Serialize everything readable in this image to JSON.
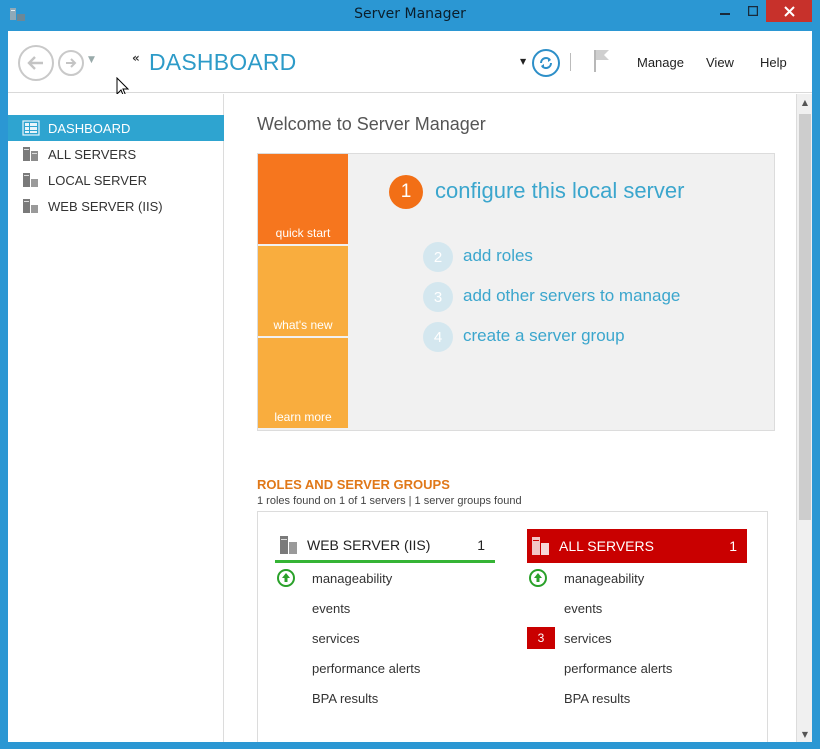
{
  "window": {
    "title": "Server Manager"
  },
  "toolbar": {
    "page_title": "DASHBOARD",
    "menus": [
      {
        "label": "Manage"
      },
      {
        "label": "View"
      },
      {
        "label": "Help"
      }
    ]
  },
  "sidebar": {
    "items": [
      {
        "label": "DASHBOARD",
        "active": true,
        "icon": "dashboard-icon"
      },
      {
        "label": "ALL SERVERS",
        "active": false,
        "icon": "servers-icon"
      },
      {
        "label": "LOCAL SERVER",
        "active": false,
        "icon": "server-icon"
      },
      {
        "label": "WEB SERVER (IIS)",
        "active": false,
        "icon": "server-icon"
      }
    ]
  },
  "main": {
    "welcome": "Welcome to Server Manager",
    "tiles": [
      {
        "label": "quick start",
        "color": "#f6761e"
      },
      {
        "label": "what's new",
        "color": "#f9ad3e"
      },
      {
        "label": "learn more",
        "color": "#f9ad3e"
      }
    ],
    "steps": [
      {
        "num": "1",
        "label": "configure this local server"
      },
      {
        "num": "2",
        "label": "add roles"
      },
      {
        "num": "3",
        "label": "add other servers to manage"
      },
      {
        "num": "4",
        "label": "create a server group"
      }
    ],
    "roles": {
      "title": "ROLES AND SERVER GROUPS",
      "subtitle": "1 roles found on 1 of 1 servers | 1 server groups found",
      "cards": [
        {
          "name": "WEB SERVER (IIS)",
          "count": "1",
          "status": "ok",
          "rows": [
            "manageability",
            "events",
            "services",
            "performance alerts",
            "BPA results"
          ]
        },
        {
          "name": "ALL SERVERS",
          "count": "1",
          "status": "alert",
          "services_alert": "3",
          "rows": [
            "manageability",
            "events",
            "services",
            "performance alerts",
            "BPA results"
          ]
        }
      ]
    }
  },
  "colors": {
    "accent": "#2ea4d0",
    "orange": "#f6761e",
    "alert_red": "#c90000",
    "ok_green": "#35b435"
  }
}
